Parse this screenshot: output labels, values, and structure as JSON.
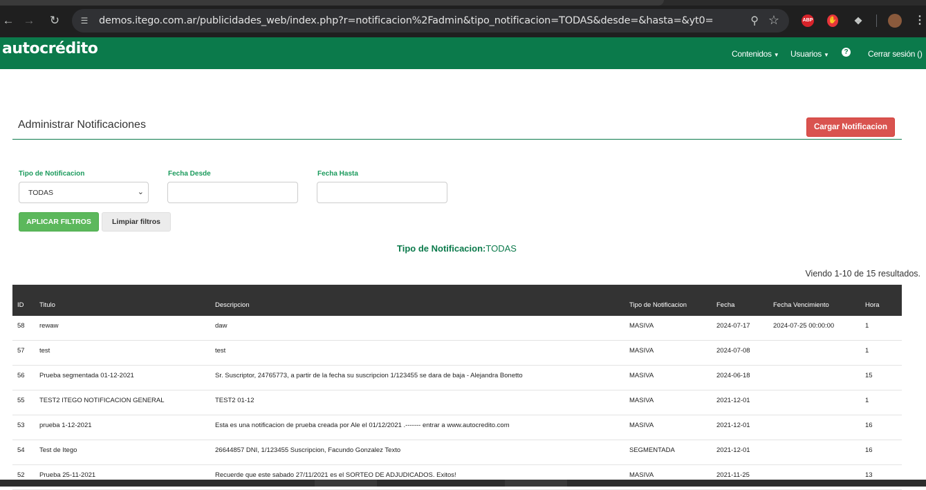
{
  "browser": {
    "url_host": "demos.itego.com.ar",
    "url_path": "/publicidades_web/index.php?r=notificacion%2Fadmin&tipo_notificacion=TODAS&desde=&hasta=&yt0=",
    "ext_abp": "ABP"
  },
  "header": {
    "brand": "autocrédito",
    "menu": [
      {
        "label": "Contenidos"
      },
      {
        "label": "Usuarios"
      }
    ],
    "help": "?",
    "logout": "Cerrar sesión ()"
  },
  "page": {
    "title": "Administrar Notificaciones",
    "add_button": "Cargar Notificacion"
  },
  "filters": {
    "tipo_label": "Tipo de Notificacion",
    "tipo_value": "TODAS",
    "desde_label": "Fecha Desde",
    "desde_value": "",
    "hasta_label": "Fecha Hasta",
    "hasta_value": "",
    "apply_button": "APLICAR FILTROS",
    "clear_button": "Limpiar filtros",
    "status_prefix": "Tipo de Notificacion:",
    "status_value": "TODAS"
  },
  "summary": "Viendo 1-10 de 15 resultados.",
  "table": {
    "columns": [
      "ID",
      "Titulo",
      "Descripcion",
      "Tipo de Notificacion",
      "Fecha",
      "Fecha Vencimiento",
      "Hora"
    ],
    "rows": [
      [
        "58",
        "rewaw",
        "daw",
        "MASIVA",
        "2024-07-17",
        "2024-07-25 00:00:00",
        "1"
      ],
      [
        "57",
        "test",
        "test",
        "MASIVA",
        "2024-07-08",
        "",
        "1"
      ],
      [
        "56",
        "Prueba segmentada 01-12-2021",
        "Sr. Suscriptor, 24765773, a partir de la fecha su suscripcion 1/123455 se dara de baja - Alejandra Bonetto",
        "MASIVA",
        "2024-06-18",
        "",
        "15"
      ],
      [
        "55",
        "TEST2 ITEGO NOTIFICACION GENERAL",
        "TEST2 01-12",
        "MASIVA",
        "2021-12-01",
        "",
        "1"
      ],
      [
        "53",
        "prueba 1-12-2021",
        "Esta es una notificacion de prueba creada por Ale el 01/12/2021 .------- entrar a www.autocredito.com",
        "MASIVA",
        "2021-12-01",
        "",
        "16"
      ],
      [
        "54",
        "Test de Itego",
        "26644857 DNI, 1/123455 Suscripcion, Facundo Gonzalez Texto",
        "SEGMENTADA",
        "2021-12-01",
        "",
        "16"
      ],
      [
        "52",
        "Prueba 25-11-2021",
        "Recuerde que este sabado 27/11/2021 es el SORTEO DE ADJUDICADOS. Exitos!",
        "MASIVA",
        "2021-11-25",
        "",
        "13"
      ]
    ]
  },
  "colors": {
    "brand_green": "#0b7a4b",
    "label_green": "#1a9a5c",
    "danger": "#d9534f",
    "success": "#5cb85c",
    "table_header": "#333333"
  }
}
